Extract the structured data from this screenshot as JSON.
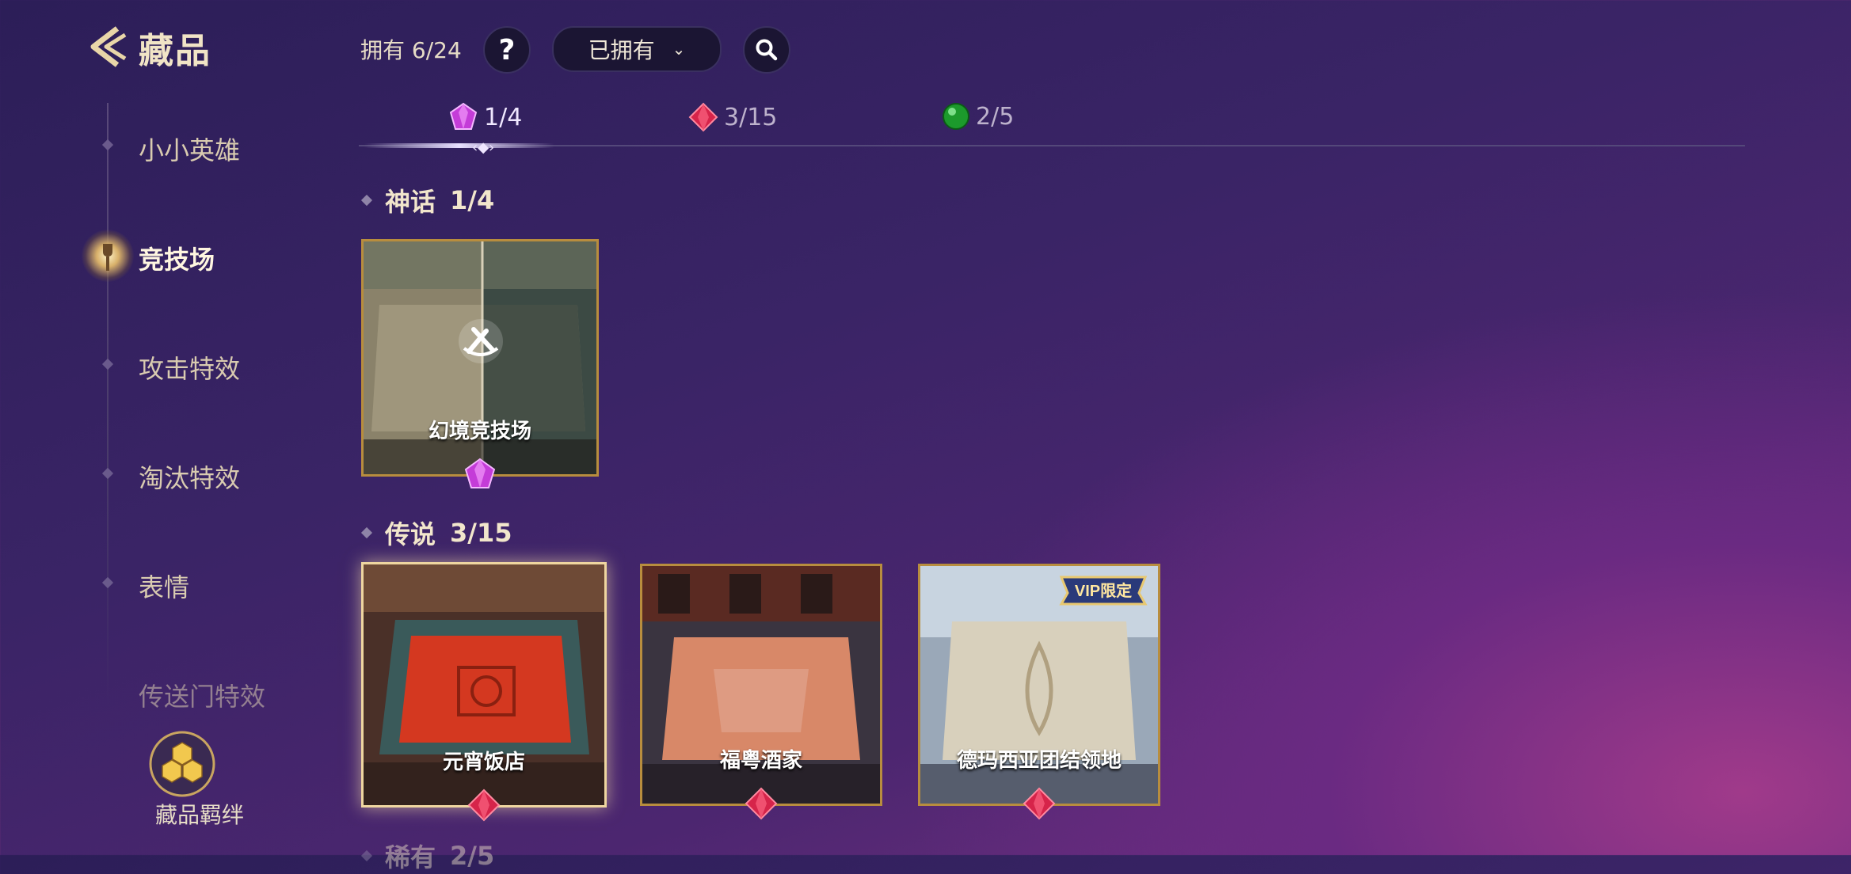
{
  "header": {
    "title": "藏品",
    "owned_label": "拥有 6/24",
    "help_label": "?",
    "filter_value": "已拥有"
  },
  "sidebar": {
    "items": [
      {
        "label": "小小英雄"
      },
      {
        "label": "竞技场"
      },
      {
        "label": "攻击特效"
      },
      {
        "label": "淘汰特效"
      },
      {
        "label": "表情"
      },
      {
        "label": "传送门特效"
      }
    ],
    "bond_label": "藏品羁绊"
  },
  "tabs": [
    {
      "count": "1/4",
      "color": "#c43cd8"
    },
    {
      "count": "3/15",
      "color": "#d6244a"
    },
    {
      "count": "2/5",
      "color": "#1c9a2c"
    }
  ],
  "sections": [
    {
      "title": "神话",
      "count": "1/4",
      "cards": [
        {
          "name": "幻境竞技场"
        }
      ]
    },
    {
      "title": "传说",
      "count": "3/15",
      "cards": [
        {
          "name": "元宵饭店"
        },
        {
          "name": "福粤酒家"
        },
        {
          "name": "德玛西亚团结领地",
          "badge": "VIP限定"
        }
      ]
    },
    {
      "title": "稀有",
      "count": "2/5"
    }
  ]
}
